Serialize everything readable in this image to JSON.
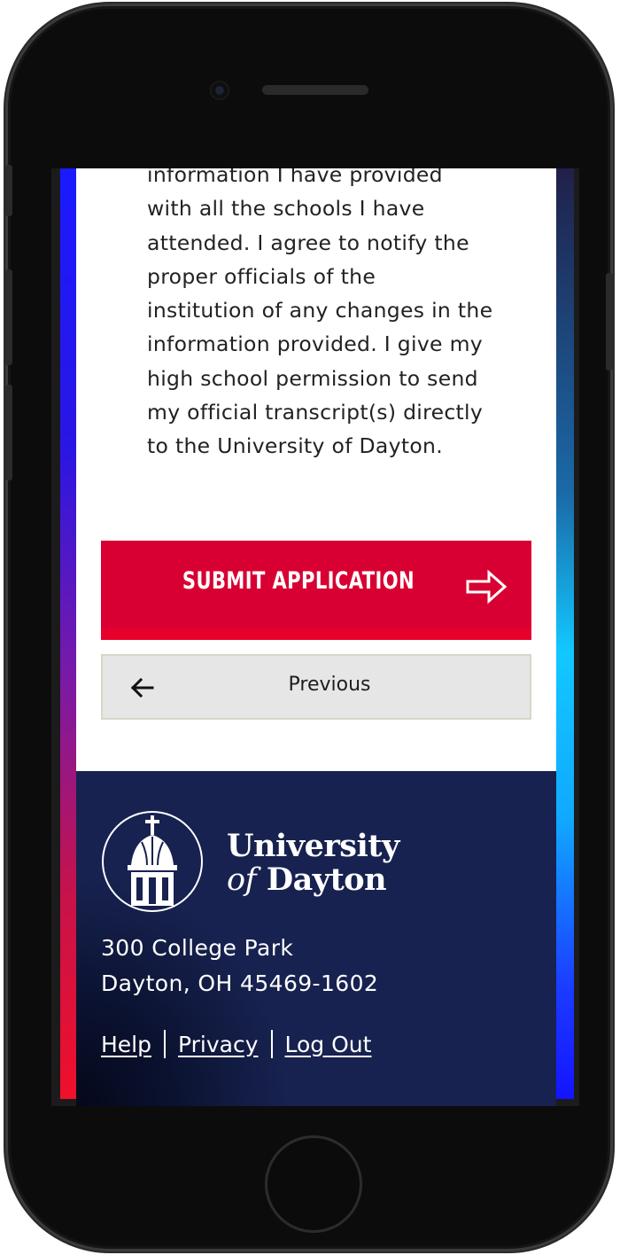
{
  "consent": {
    "lines": [
      "information I have provided",
      "with all the schools I have",
      "attended. I agree to notify the",
      "proper officials of the",
      "institution of any changes in the",
      "information provided. I give my",
      "high school permission to send",
      "my official transcript(s) directly",
      "to the University of Dayton."
    ]
  },
  "actions": {
    "submit_label": "SUBMIT APPLICATION",
    "submit_icon": "arrow-right-icon",
    "previous_label": "Previous",
    "previous_icon": "arrow-left-icon"
  },
  "footer": {
    "wordmark_line1": "University",
    "wordmark_of": "of",
    "wordmark_line2": "Dayton",
    "address_line1": "300 College Park",
    "address_line2": "Dayton, OH 45469-1602",
    "links": [
      "Help",
      "Privacy",
      "Log Out"
    ]
  },
  "colors": {
    "submit_red": "#d80032",
    "footer_navy": "#172250",
    "previous_gray": "#e6e6e6"
  }
}
